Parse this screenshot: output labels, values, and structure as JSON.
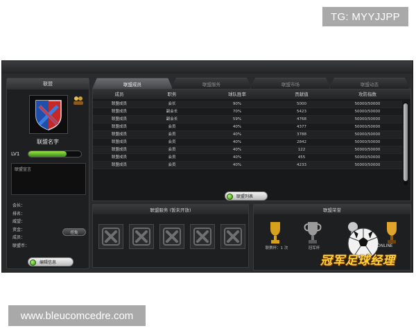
{
  "watermarks": {
    "top_right": "TG: MYYJJPP",
    "bottom_left": "www.bleucomcedre.com"
  },
  "left_panel": {
    "title": "联盟",
    "league_name": "联盟名字",
    "level_label": "LV1",
    "level_progress": 0.72,
    "declaration_label": "联盟宣言",
    "stats": [
      "会长：",
      "排名：",
      "威望：",
      "资金：",
      "成员：",
      "联盟币："
    ],
    "small_button": "任免",
    "edit_button": "编辑信息"
  },
  "tabs": [
    {
      "label": "联盟成员",
      "active": true
    },
    {
      "label": "联盟服务",
      "active": false
    },
    {
      "label": "联盟市场",
      "active": false
    },
    {
      "label": "联盟动态",
      "active": false
    }
  ],
  "members_table": {
    "headers": [
      "成员",
      "职务",
      "球队胜率",
      "贡献值",
      "攻防指数"
    ],
    "rows": [
      [
        "联盟成员",
        "会长",
        "90%",
        "5000",
        "50000/50000"
      ],
      [
        "联盟成员",
        "副会长",
        "70%",
        "5423",
        "50000/50000"
      ],
      [
        "联盟成员",
        "副会长",
        "59%",
        "4768",
        "50000/50000"
      ],
      [
        "联盟成员",
        "会员",
        "40%",
        "4377",
        "50000/50000"
      ],
      [
        "联盟成员",
        "会员",
        "40%",
        "3788",
        "50000/50000"
      ],
      [
        "联盟成员",
        "会员",
        "40%",
        "2842",
        "50000/50000"
      ],
      [
        "联盟成员",
        "会员",
        "40%",
        "122",
        "50000/50000"
      ],
      [
        "联盟成员",
        "会员",
        "40%",
        "455",
        "50000/50000"
      ],
      [
        "联盟成员",
        "会员",
        "40%",
        "4233",
        "50000/50000"
      ]
    ],
    "list_button": "联盟列表"
  },
  "services": {
    "title": "联盟服务 (暂未开放)",
    "slot_count": 5
  },
  "honors": {
    "title": "联盟荣誉",
    "trophies": [
      {
        "caption": "联赛杯：1 次",
        "color": "#d6a21e"
      },
      {
        "caption": "冠军杯",
        "color": "#9a9a9a"
      },
      {
        "caption": "",
        "color": "#c9c9c9"
      },
      {
        "caption": "",
        "color": "#e0a52a"
      }
    ],
    "online_tag": "ONLINE",
    "game_logo": "冠军足球经理"
  },
  "colors": {
    "progress_green": "#6cc72b",
    "panel_bg": "#1e1f20",
    "logo_gold": "#ffd23a"
  }
}
